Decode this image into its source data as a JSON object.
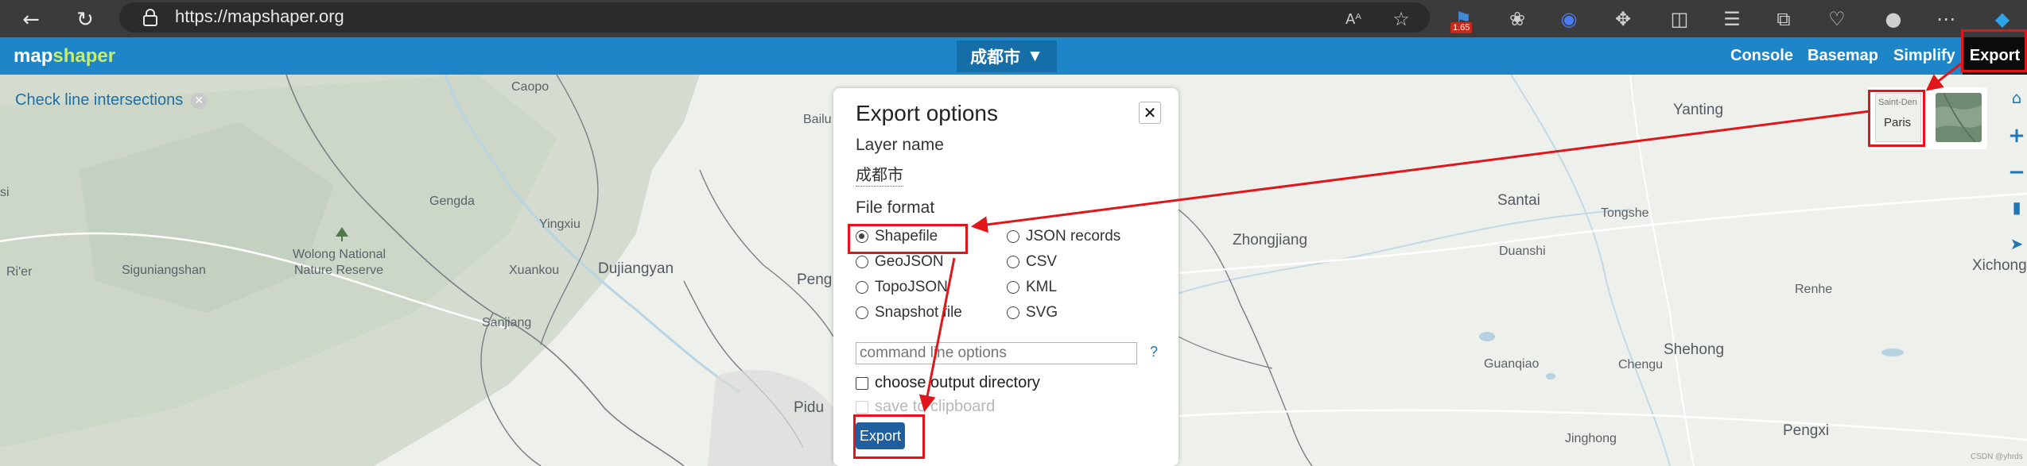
{
  "browser": {
    "url": "https://mapshaper.org",
    "badge": "1.65"
  },
  "app": {
    "logo_map": "map",
    "logo_shaper": "shaper",
    "layer_selector": "成都市",
    "layer_arrow": "▼",
    "nav": [
      "Console",
      "Basemap",
      "Simplify",
      "Export"
    ]
  },
  "map": {
    "intersections_label": "Check line intersections",
    "places": [
      {
        "name": "Caopo"
      },
      {
        "name": "Gengda"
      },
      {
        "name": "Wolong National"
      },
      {
        "name": "Nature Reserve"
      },
      {
        "name": "Ri'er"
      },
      {
        "name": "Siguniangshan"
      },
      {
        "name": "Sanjiang"
      },
      {
        "name": "Xuankou"
      },
      {
        "name": "Yingxiu"
      },
      {
        "name": "Dujiangyan"
      },
      {
        "name": "Bailu"
      },
      {
        "name": "Peng"
      },
      {
        "name": "Pidu"
      },
      {
        "name": "Zhongjiang"
      },
      {
        "name": "Santai"
      },
      {
        "name": "Tongshe"
      },
      {
        "name": "Duanshi"
      },
      {
        "name": "Yanting"
      },
      {
        "name": "Renhe"
      },
      {
        "name": "Shehong"
      },
      {
        "name": "Guanqiao"
      },
      {
        "name": "Chengu"
      },
      {
        "name": "Xichong"
      },
      {
        "name": "Pengxi"
      },
      {
        "name": "Jinghong"
      },
      {
        "name": "si"
      }
    ],
    "basemap_thumb_labels": [
      "Saint-Den",
      "Paris"
    ]
  },
  "dialog": {
    "title": "Export options",
    "close": "✕",
    "layer_name_label": "Layer name",
    "layer_name_value": "成都市",
    "file_format_label": "File format",
    "formats": [
      {
        "label": "Shapefile",
        "selected": true
      },
      {
        "label": "GeoJSON",
        "selected": false
      },
      {
        "label": "TopoJSON",
        "selected": false
      },
      {
        "label": "Snapshot file",
        "selected": false
      },
      {
        "label": "JSON records",
        "selected": false
      },
      {
        "label": "CSV",
        "selected": false
      },
      {
        "label": "KML",
        "selected": false
      },
      {
        "label": "SVG",
        "selected": false
      }
    ],
    "command_placeholder": "command line options",
    "help": "?",
    "choose_dir_label": "choose output directory",
    "clipboard_label": "save to clipboard",
    "export_button": "Export"
  },
  "watermark": "CSDN @yhrds",
  "colors": {
    "header_blue": "#1e86c8",
    "logo_accent": "#c6ee6a",
    "annotation_red": "#e0161b",
    "export_button": "#1f5f9e"
  }
}
